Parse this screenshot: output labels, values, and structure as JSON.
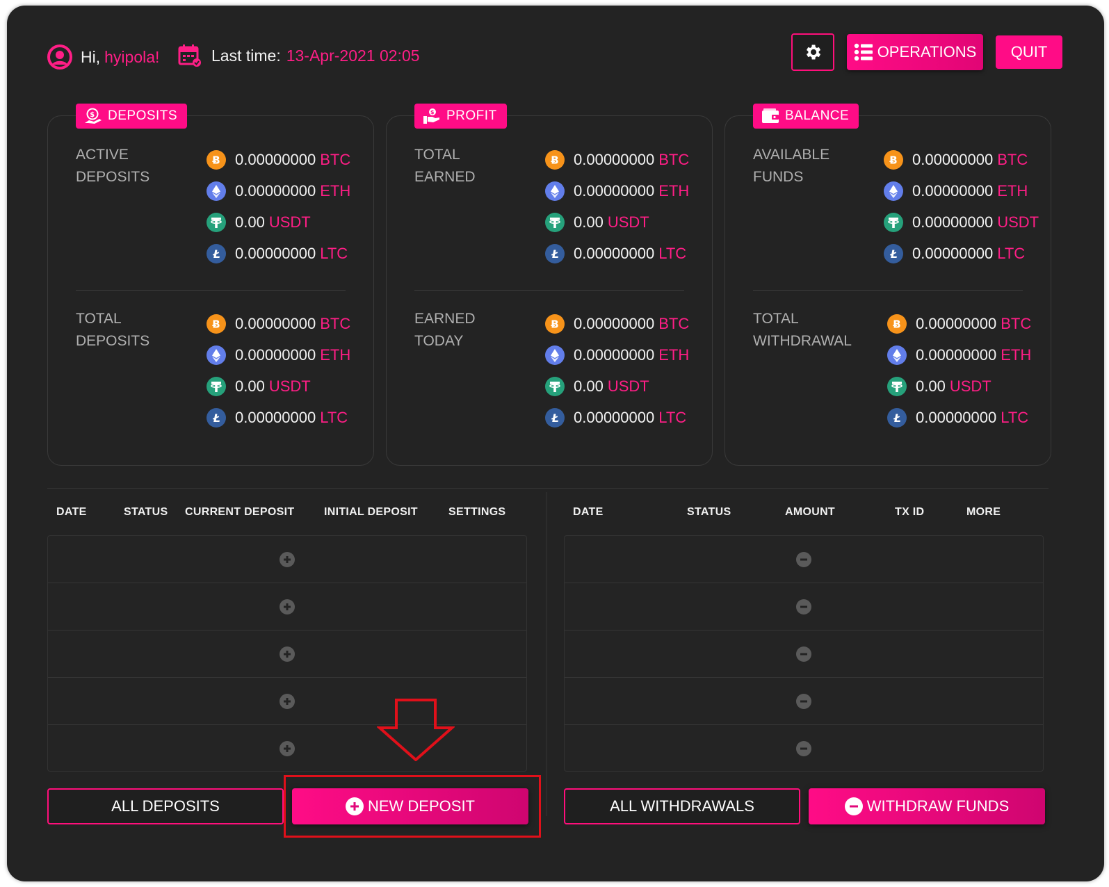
{
  "header": {
    "greeting": "Hi,",
    "username": "hyipola!",
    "last_time_label": "Last time:",
    "last_time_value": "13-Apr-2021 02:05",
    "operations_label": "OPERATIONS",
    "quit_label": "QUIT"
  },
  "colors": {
    "accent": "#ff0c86",
    "background": "#232323",
    "btc": "#f7931a",
    "eth": "#627eea",
    "usdt": "#26a17b",
    "ltc": "#345d9d"
  },
  "cards": [
    {
      "title": "DEPOSITS",
      "icon": "deposit-hand-icon",
      "sections": [
        {
          "label_line1": "ACTIVE",
          "label_line2": "DEPOSITS",
          "rows": [
            {
              "coin": "BTC",
              "amount": "0.00000000",
              "currency": "BTC"
            },
            {
              "coin": "ETH",
              "amount": "0.00000000",
              "currency": "ETH"
            },
            {
              "coin": "USDT",
              "amount": "0.00",
              "currency": "USDT"
            },
            {
              "coin": "LTC",
              "amount": "0.00000000",
              "currency": "LTC"
            }
          ]
        },
        {
          "label_line1": "TOTAL",
          "label_line2": "DEPOSITS",
          "rows": [
            {
              "coin": "BTC",
              "amount": "0.00000000",
              "currency": "BTC"
            },
            {
              "coin": "ETH",
              "amount": "0.00000000",
              "currency": "ETH"
            },
            {
              "coin": "USDT",
              "amount": "0.00",
              "currency": "USDT"
            },
            {
              "coin": "LTC",
              "amount": "0.00000000",
              "currency": "LTC"
            }
          ]
        }
      ]
    },
    {
      "title": "PROFIT",
      "icon": "profit-hand-icon",
      "sections": [
        {
          "label_line1": "TOTAL",
          "label_line2": "EARNED",
          "rows": [
            {
              "coin": "BTC",
              "amount": "0.00000000",
              "currency": "BTC"
            },
            {
              "coin": "ETH",
              "amount": "0.00000000",
              "currency": "ETH"
            },
            {
              "coin": "USDT",
              "amount": "0.00",
              "currency": "USDT"
            },
            {
              "coin": "LTC",
              "amount": "0.00000000",
              "currency": "LTC"
            }
          ]
        },
        {
          "label_line1": "EARNED",
          "label_line2": "TODAY",
          "rows": [
            {
              "coin": "BTC",
              "amount": "0.00000000",
              "currency": "BTC"
            },
            {
              "coin": "ETH",
              "amount": "0.00000000",
              "currency": "ETH"
            },
            {
              "coin": "USDT",
              "amount": "0.00",
              "currency": "USDT"
            },
            {
              "coin": "LTC",
              "amount": "0.00000000",
              "currency": "LTC"
            }
          ]
        }
      ]
    },
    {
      "title": "BALANCE",
      "icon": "wallet-icon",
      "sections": [
        {
          "label_line1": "AVAILABLE",
          "label_line2": "FUNDS",
          "rows": [
            {
              "coin": "BTC",
              "amount": "0.00000000",
              "currency": "BTC"
            },
            {
              "coin": "ETH",
              "amount": "0.00000000",
              "currency": "ETH"
            },
            {
              "coin": "USDT",
              "amount": "0.00000000",
              "currency": "USDT"
            },
            {
              "coin": "LTC",
              "amount": "0.00000000",
              "currency": "LTC"
            }
          ]
        },
        {
          "label_line1": "TOTAL",
          "label_line2": "WITHDRAWAL",
          "rows": [
            {
              "coin": "BTC",
              "amount": "0.00000000",
              "currency": "BTC"
            },
            {
              "coin": "ETH",
              "amount": "0.00000000",
              "currency": "ETH"
            },
            {
              "coin": "USDT",
              "amount": "0.00",
              "currency": "USDT"
            },
            {
              "coin": "LTC",
              "amount": "0.00000000",
              "currency": "LTC"
            }
          ]
        }
      ]
    }
  ],
  "deposits_table": {
    "columns": [
      "DATE",
      "STATUS",
      "CURRENT DEPOSIT",
      "INITIAL DEPOSIT",
      "SETTINGS"
    ],
    "empty_rows": 5,
    "row_icon": "plus-circle-icon"
  },
  "withdrawals_table": {
    "columns": [
      "DATE",
      "STATUS",
      "AMOUNT",
      "TX ID",
      "MORE"
    ],
    "empty_rows": 5,
    "row_icon": "minus-circle-icon"
  },
  "buttons": {
    "all_deposits": "ALL DEPOSITS",
    "new_deposit": "NEW DEPOSIT",
    "all_withdrawals": "ALL WITHDRAWALS",
    "withdraw_funds": "WITHDRAW FUNDS"
  }
}
